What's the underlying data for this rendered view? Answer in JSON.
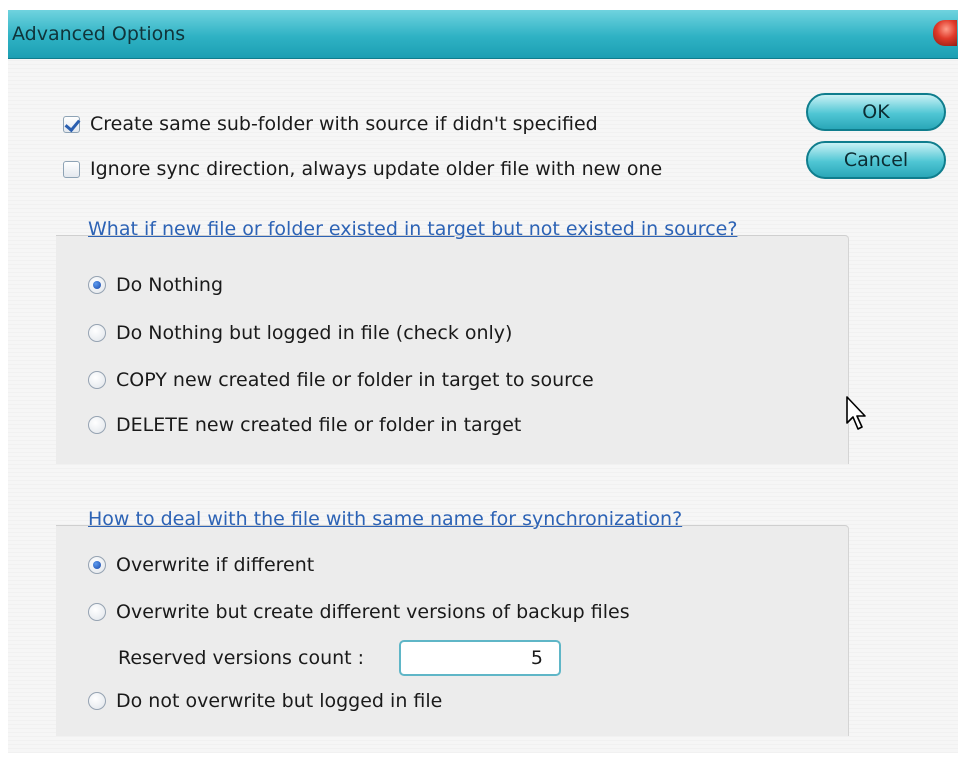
{
  "window": {
    "title": "Advanced Options"
  },
  "options": {
    "create_subfolder": {
      "label": "Create same sub-folder with source if didn't specified",
      "checked": true
    },
    "ignore_direction": {
      "label": "Ignore sync direction, always update older file with new one",
      "checked": false
    }
  },
  "buttons": {
    "ok": "OK",
    "cancel": "Cancel"
  },
  "group1": {
    "title": "What if new file or folder existed in target but not existed in source?",
    "options": [
      {
        "label": "Do Nothing",
        "selected": true
      },
      {
        "label": "Do Nothing but logged in file (check only)",
        "selected": false
      },
      {
        "label": "COPY new created file or folder in target to source",
        "selected": false
      },
      {
        "label": "DELETE new created file or folder in target",
        "selected": false
      }
    ]
  },
  "group2": {
    "title": "How to deal with the file with same name for synchronization?",
    "options": [
      {
        "label": "Overwrite if different",
        "selected": true
      },
      {
        "label": "Overwrite but create different versions of backup files",
        "selected": false
      },
      {
        "label": "Do not overwrite but logged in file",
        "selected": false
      }
    ],
    "reserved_label": "Reserved versions count :",
    "reserved_value": "5"
  },
  "colors": {
    "titlebar": "#2fb2c4",
    "link": "#2d63b5",
    "button": "#4fc6d4"
  },
  "icons": {
    "close": "close-icon",
    "pointer": "mouse-cursor-icon"
  }
}
